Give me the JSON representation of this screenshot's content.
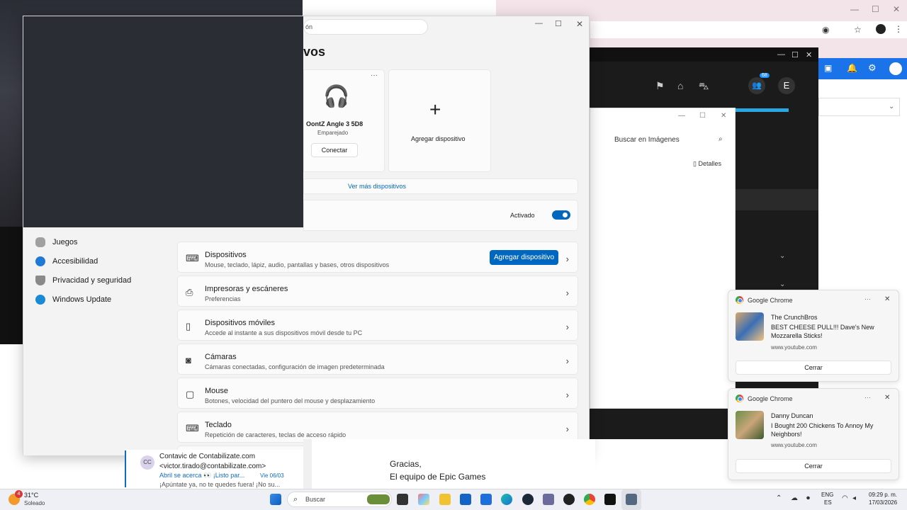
{
  "background_apps": {
    "bg_window_buttons": [
      "—",
      "☐",
      "✕"
    ],
    "dark_app_buttons": [
      "—",
      "☐",
      "✕"
    ],
    "dark_app_badge": "68",
    "dark_app_avatar": "E",
    "explorer": {
      "search_placeholder": "Buscar en Imágenes",
      "details_label": "Detalles"
    }
  },
  "settings": {
    "search_partial": "ón",
    "heading_partial": "vos",
    "device_card": {
      "name": "OontZ Angle 3 5D8",
      "status": "Emparejado",
      "connect_label": "Conectar",
      "more": "···"
    },
    "add_card_label": "Agregar dispositivo",
    "see_more": "Ver más dispositivos",
    "bluetooth_toggle": {
      "label": "Activado",
      "on": true
    },
    "nav": [
      {
        "label": "Juegos",
        "icon": "gamepad-icon"
      },
      {
        "label": "Accesibilidad",
        "icon": "accessibility-icon"
      },
      {
        "label": "Privacidad y seguridad",
        "icon": "shield-icon"
      },
      {
        "label": "Windows Update",
        "icon": "update-icon"
      }
    ],
    "rows": [
      {
        "title": "Dispositivos",
        "sub": "Mouse, teclado, lápiz, audio, pantallas y bases, otros dispositivos",
        "icon": "devices-icon",
        "button": "Agregar dispositivo"
      },
      {
        "title": "Impresoras y escáneres",
        "sub": "Preferencias",
        "icon": "printer-icon"
      },
      {
        "title": "Dispositivos móviles",
        "sub": "Accede al instante a sus dispositivos móvil desde tu PC",
        "icon": "phone-icon"
      },
      {
        "title": "Cámaras",
        "sub": "Cámaras conectadas, configuración de imagen predeterminada",
        "icon": "camera-icon"
      },
      {
        "title": "Mouse",
        "sub": "Botones, velocidad del puntero del mouse y desplazamiento",
        "icon": "mouse-icon"
      },
      {
        "title": "Teclado",
        "sub": "Repetición de caracteres, teclas de acceso rápido",
        "icon": "keyboard-icon"
      }
    ]
  },
  "notifications": [
    {
      "app": "Google Chrome",
      "title": "The CrunchBros",
      "body": "BEST CHEESE PULL!!! Dave's New Mozzarella Sticks!",
      "source": "www.youtube.com",
      "button": "Cerrar"
    },
    {
      "app": "Google Chrome",
      "title": "Danny Duncan",
      "body": "I Bought 200 Chickens To Annoy My Neighbors!",
      "source": "www.youtube.com",
      "button": "Cerrar"
    }
  ],
  "mail": {
    "avatar": "CC",
    "sender": "Contavic de Contabilizate.com",
    "address": "<victor.tirado@contabilizate.com>",
    "subject": "Abril se acerca 👀 ¡Listo par...",
    "date": "Vie 06/03",
    "preview": "¡Apúntate ya, no te quedes fuera! ¡No su..."
  },
  "epic": {
    "line1": "Gracias,",
    "line2": "El equipo de Epic Games"
  },
  "taskbar": {
    "weather_temp": "31°C",
    "weather_desc": "Soleado",
    "weather_badge": "4",
    "search_label": "Buscar",
    "lang1": "ENG",
    "lang2": "ES",
    "time": "09:29 p. m.",
    "date": "17/03/2026"
  }
}
